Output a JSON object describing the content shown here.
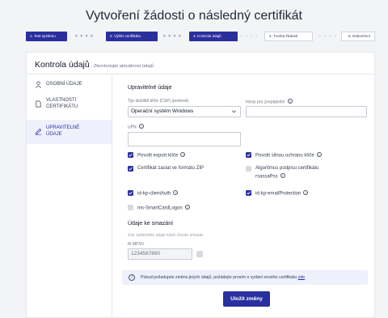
{
  "page_title": "Vytvoření žádosti o následný certifikát",
  "stepper": {
    "steps": [
      {
        "label": "1. Test systému"
      },
      {
        "label": "2. Výběr certifikátu"
      },
      {
        "label": "3. Kontrola údajů"
      },
      {
        "label": "4. Tvorba žádosti"
      },
      {
        "label": "5. Dokončení"
      }
    ],
    "separator": "> > > >"
  },
  "card": {
    "title": "Kontrola údajů",
    "subtitle": " - Zkontrolujte aktuálnost údajů"
  },
  "sidebar": {
    "items": [
      {
        "label_line1": "OSOBNÍ ÚDAJE",
        "label_line2": "",
        "icon": "person-icon"
      },
      {
        "label_line1": "VLASTNOSTI",
        "label_line2": "CERTIFIKÁTU",
        "icon": "document-icon"
      },
      {
        "label_line1": "UPRAVITELNÉ",
        "label_line2": "ÚDAJE",
        "icon": "pencil-icon"
      }
    ]
  },
  "editable": {
    "section_title": "Upravitelné údaje",
    "key_type_label": "Typ úložiště klíče (CSP) (povinné)",
    "key_type_value": "Operační systém Windows",
    "password_label": "Heslo pro znepl​atnění",
    "password_value": "",
    "upn_label": "UPN",
    "upn_value": ""
  },
  "checkboxes": [
    {
      "label": "Povolit export klíče",
      "checked": true,
      "info": true
    },
    {
      "label": "Povolit silnou ochranu klíče",
      "checked": true,
      "info": true
    },
    {
      "label": "Certifikát zaslat ve formátu ZIP",
      "checked": true,
      "info": false
    },
    {
      "label": "Algoritmus podpisu certifikátu",
      "label2": "rsassaPss",
      "checked": false,
      "info": true
    },
    {
      "label": "id-kp-clientAuth",
      "checked": true,
      "info": true
    },
    {
      "label": "id-kp-emailProtection",
      "checked": true,
      "info": true
    },
    {
      "label": "ms-SmartCardLogon",
      "checked": false,
      "info": true
    }
  ],
  "delete_section": {
    "title": "Údaje ke smazání",
    "hint": "Zde zaškrtněte údaje které chcete smazat.",
    "ik_label": "IK MPSV",
    "ik_value": "1234567890"
  },
  "notice": {
    "text": "Pokud požadujete změnu jiných údajů, požádejte prosím o vydání nového certifikátu",
    "link": "zde",
    "end": "."
  },
  "save_button": "Uložit změny",
  "colors": {
    "primary": "#2a2f9e",
    "active_bg": "#eef0fb"
  }
}
